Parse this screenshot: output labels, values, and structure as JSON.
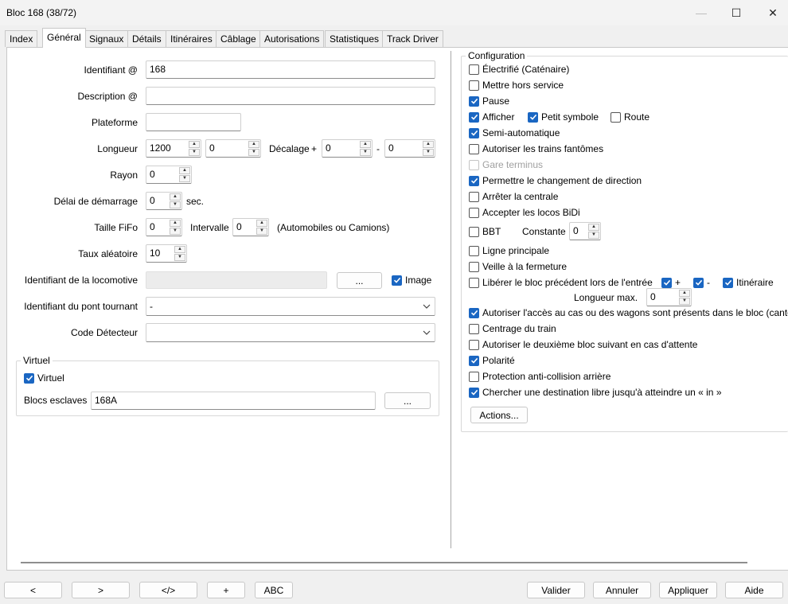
{
  "window": {
    "title": "Bloc 168 (38/72)",
    "minimize": "—",
    "maximize": "☐",
    "close": "✕"
  },
  "tabs": [
    "Index",
    "Général",
    "Signaux",
    "Détails",
    "Itinéraires",
    "Câblage",
    "Autorisations",
    "Statistiques",
    "Track Driver"
  ],
  "active_tab": "Général",
  "form": {
    "identifiant_label": "Identifiant @",
    "identifiant_value": "168",
    "description_label": "Description @",
    "description_value": "",
    "plateforme_label": "Plateforme",
    "plateforme_value": "",
    "longueur_label": "Longueur",
    "longueur_value": "1200",
    "longueur_second_value": "0",
    "decalage_label": "Décalage",
    "decalage_plus": "+",
    "decalage_plus_value": "0",
    "decalage_minus": "-",
    "decalage_minus_value": "0",
    "rayon_label": "Rayon",
    "rayon_value": "0",
    "delai_label": "Délai de démarrage",
    "delai_value": "0",
    "delai_unit": "sec.",
    "taille_label": "Taille  FiFo",
    "taille_value": "0",
    "intervalle_label": "Intervalle",
    "intervalle_value": "0",
    "automobiles_note": "(Automobiles ou Camions)",
    "taux_label": "Taux aléatoire",
    "taux_value": "10",
    "loco_label": "Identifiant de la locomotive",
    "loco_button": "...",
    "image_label": "Image",
    "image_checked": true,
    "pont_label": "Identifiant du pont tournant",
    "pont_value": "-",
    "detecteur_label": "Code Détecteur",
    "detecteur_value": ""
  },
  "virtuel": {
    "group_title": "Virtuel",
    "checkbox_label": "Virtuel",
    "checked": true,
    "esclaves_label": "Blocs esclaves",
    "esclaves_value": "168A",
    "esclaves_button": "..."
  },
  "configuration": {
    "group_title": "Configuration",
    "electrifie": "Électrifié (Caténaire)",
    "hors_service": "Mettre hors service",
    "pause": "Pause",
    "afficher": "Afficher",
    "petit_symbole": "Petit symbole",
    "route": "Route",
    "semi_auto": "Semi-automatique",
    "fantomes": "Autoriser les trains fantômes",
    "gare_terminus": "Gare terminus",
    "changement_direction": "Permettre le changement de direction",
    "arreter_centrale": "Arrêter la centrale",
    "bidi": "Accepter les locos BiDi",
    "bbt": "BBT",
    "constante_label": "Constante",
    "constante_value": "0",
    "ligne_principale": "Ligne principale",
    "veille": "Veille à la fermeture",
    "liberer": "Libérer le bloc précédent lors de l'entrée",
    "plus": "+",
    "minus": "-",
    "itineraire": "Itinéraire",
    "longueur_max_label": "Longueur max.",
    "longueur_max_value": "0",
    "autoriser_acces": "Autoriser l'accès au cas ou des wagons sont présents dans le bloc (canto",
    "centrage": "Centrage du train",
    "deuxieme_bloc": "Autoriser le deuxième bloc suivant en cas d'attente",
    "polarite": "Polarité",
    "anti_collision": "Protection anti-collision arrière",
    "chercher": "Chercher une destination libre jusqu'à atteindre un « in »",
    "actions_button": "Actions...",
    "checked": {
      "electrifie": false,
      "hors_service": false,
      "pause": true,
      "afficher": true,
      "petit_symbole": true,
      "route": false,
      "semi_auto": true,
      "fantomes": false,
      "gare_terminus": false,
      "changement_direction": true,
      "arreter_centrale": false,
      "bidi": false,
      "bbt": false,
      "ligne_principale": false,
      "veille": false,
      "liberer": false,
      "plus": true,
      "minus": true,
      "itineraire": true,
      "autoriser_acces": true,
      "centrage": false,
      "deuxieme_bloc": false,
      "polarite": true,
      "anti_collision": false,
      "chercher": true
    }
  },
  "footer": {
    "prev": "<",
    "next": ">",
    "code": "</>",
    "add": "+",
    "abc": "ABC",
    "valider": "Valider",
    "annuler": "Annuler",
    "appliquer": "Appliquer",
    "aide": "Aide"
  },
  "colors": {
    "accent": "#1a66c2",
    "window_bg": "#f0f0f0",
    "panel_bg": "#ffffff"
  }
}
